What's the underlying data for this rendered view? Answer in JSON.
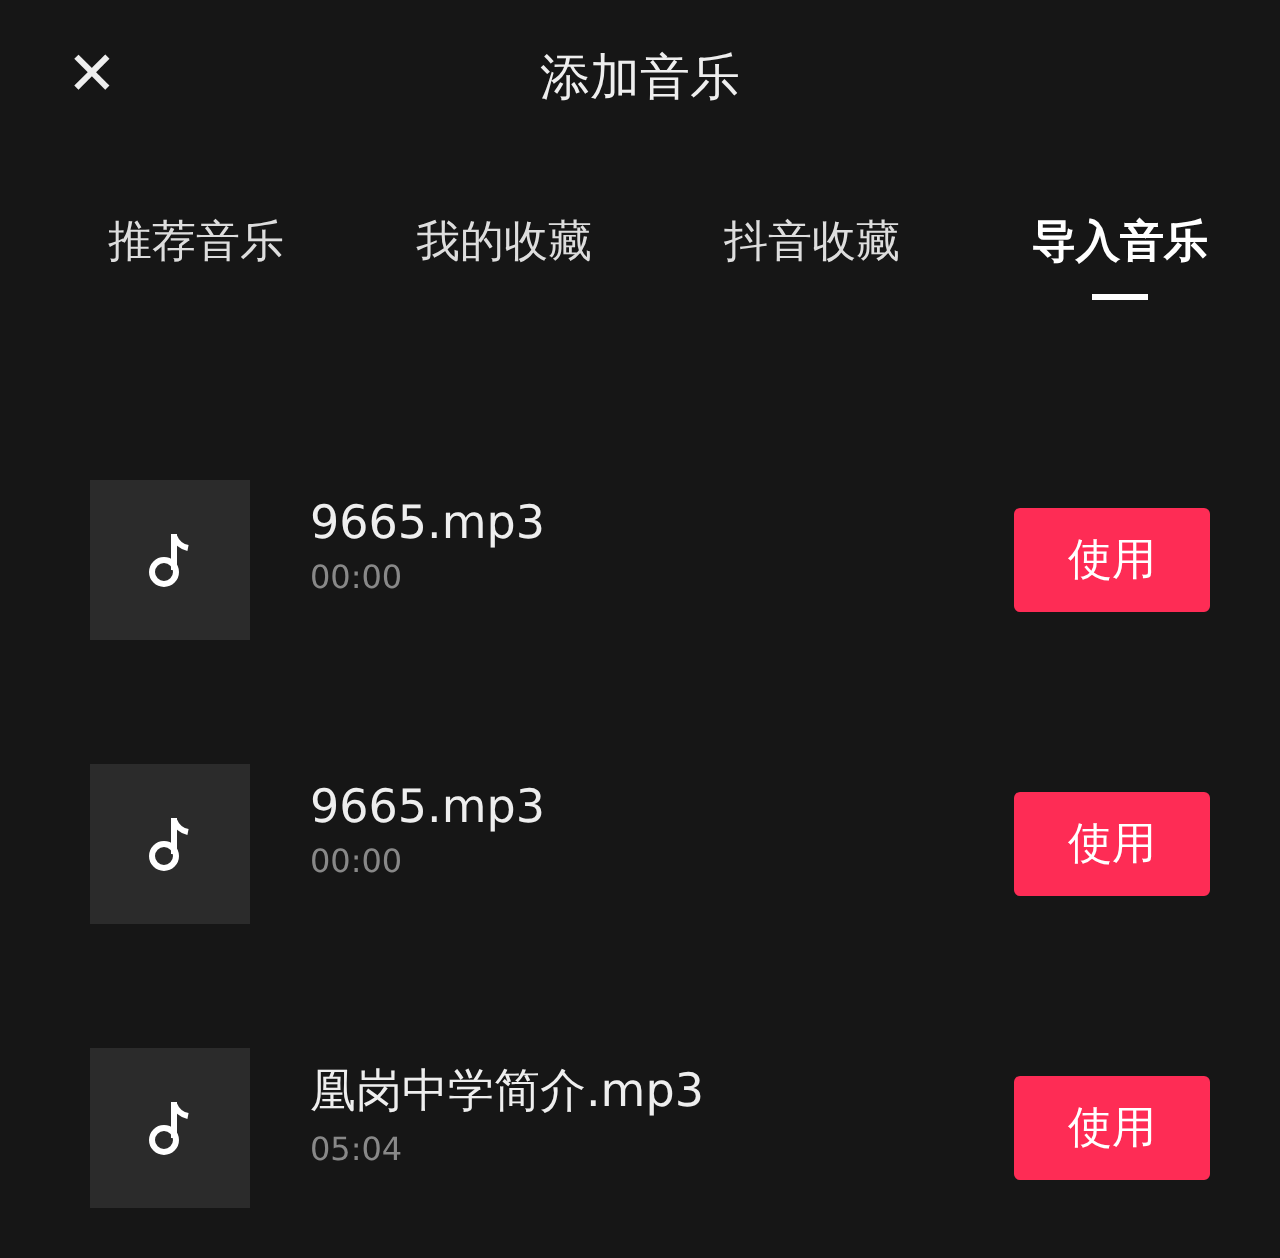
{
  "header": {
    "close": "✕",
    "title": "添加音乐"
  },
  "tabs": [
    {
      "label": "推荐音乐",
      "selected": false
    },
    {
      "label": "我的收藏",
      "selected": false
    },
    {
      "label": "抖音收藏",
      "selected": false
    },
    {
      "label": "导入音乐",
      "selected": true
    }
  ],
  "tracks": [
    {
      "name": "9665.mp3",
      "duration": "00:00",
      "action": "使用"
    },
    {
      "name": "9665.mp3",
      "duration": "00:00",
      "action": "使用"
    },
    {
      "name": "凰岗中学简介.mp3",
      "duration": "05:04",
      "action": "使用"
    }
  ]
}
